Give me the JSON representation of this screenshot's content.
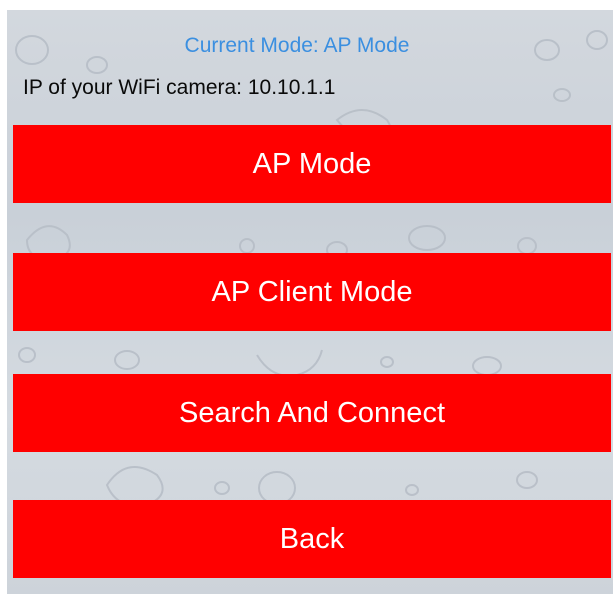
{
  "status": {
    "current_mode": "Current Mode: AP Mode",
    "ip_text": "IP of your WiFi camera: 10.10.1.1"
  },
  "buttons": {
    "ap_mode": "AP Mode",
    "ap_client_mode": "AP Client Mode",
    "search_and_connect": "Search And Connect",
    "back": "Back"
  },
  "colors": {
    "button_bg": "#ff0000",
    "button_text": "#ffffff",
    "mode_text": "#3b8fe0",
    "body_text": "#0a0a0a"
  }
}
